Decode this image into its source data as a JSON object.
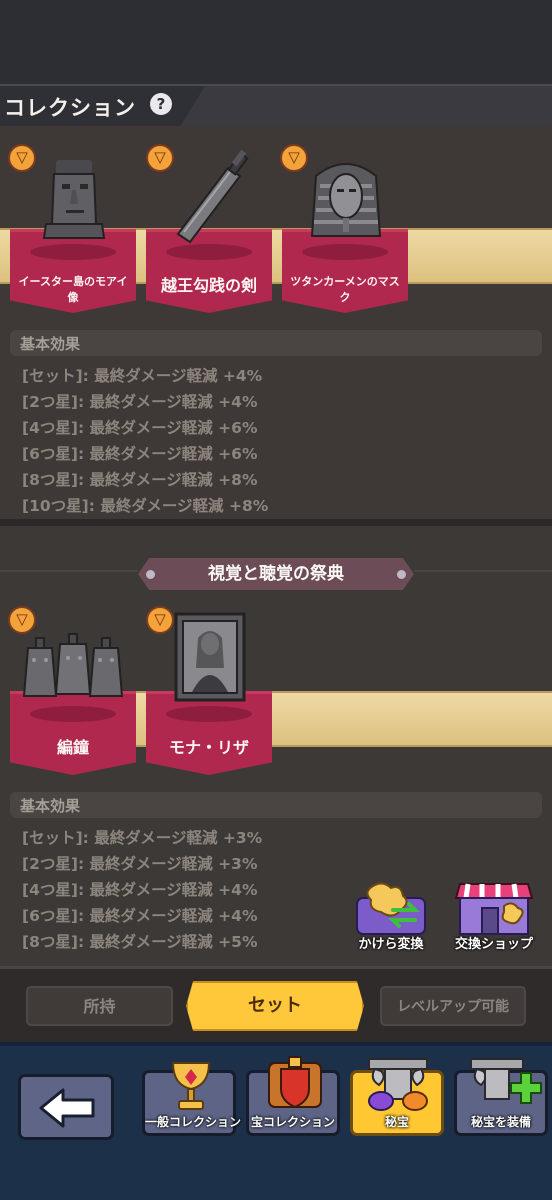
{
  "header": {
    "title": "コレクション",
    "help_icon": "?"
  },
  "set1": {
    "cards": [
      {
        "name": "イースター島のモアイ像",
        "icon": "moai-statue"
      },
      {
        "name": "越王勾践の剣",
        "icon": "bronze-sword"
      },
      {
        "name": "ツタンカーメンのマスク",
        "icon": "pharaoh-mask"
      }
    ],
    "effects_title": "基本効果",
    "effects": [
      "[セット]: 最終ダメージ軽減 +4%",
      "[2つ星]: 最終ダメージ軽減 +4%",
      "[4つ星]: 最終ダメージ軽減 +6%",
      "[6つ星]: 最終ダメージ軽減 +6%",
      "[8つ星]: 最終ダメージ軽減 +8%",
      "[10つ星]: 最終ダメージ軽減 +8%"
    ]
  },
  "set2": {
    "title": "視覚と聴覚の祭典",
    "cards": [
      {
        "name": "編鐘",
        "icon": "bronze-bells"
      },
      {
        "name": "モナ・リザ",
        "icon": "mona-lisa-painting"
      }
    ],
    "effects_title": "基本効果",
    "effects": [
      "[セット]: 最終ダメージ軽減 +3%",
      "[2つ星]: 最終ダメージ軽減 +3%",
      "[4つ星]: 最終ダメージ軽減 +4%",
      "[6つ星]: 最終ダメージ軽減 +4%",
      "[8つ星]: 最終ダメージ軽減 +5%"
    ]
  },
  "floating": {
    "fragment_convert": "かけら変換",
    "exchange_shop": "交換ショップ"
  },
  "tabs": {
    "owned": "所持",
    "set": "セット",
    "upgradable": "レベルアップ可能",
    "active": "set"
  },
  "nav": {
    "back_icon": "arrow-left",
    "items": [
      {
        "label": "一般コレクション",
        "icon": "golden-chalice"
      },
      {
        "label": "宝コレクション",
        "icon": "treasure-shield"
      },
      {
        "label": "秘宝",
        "icon": "relic-pedestal",
        "active": true
      },
      {
        "label": "秘宝を装備",
        "icon": "relic-equip-plus"
      }
    ]
  },
  "colors": {
    "ribbon": "#b0284d",
    "tab_active": "#ffc83a",
    "nav_bg": "#1d3049",
    "badge": "#f2a43a"
  }
}
